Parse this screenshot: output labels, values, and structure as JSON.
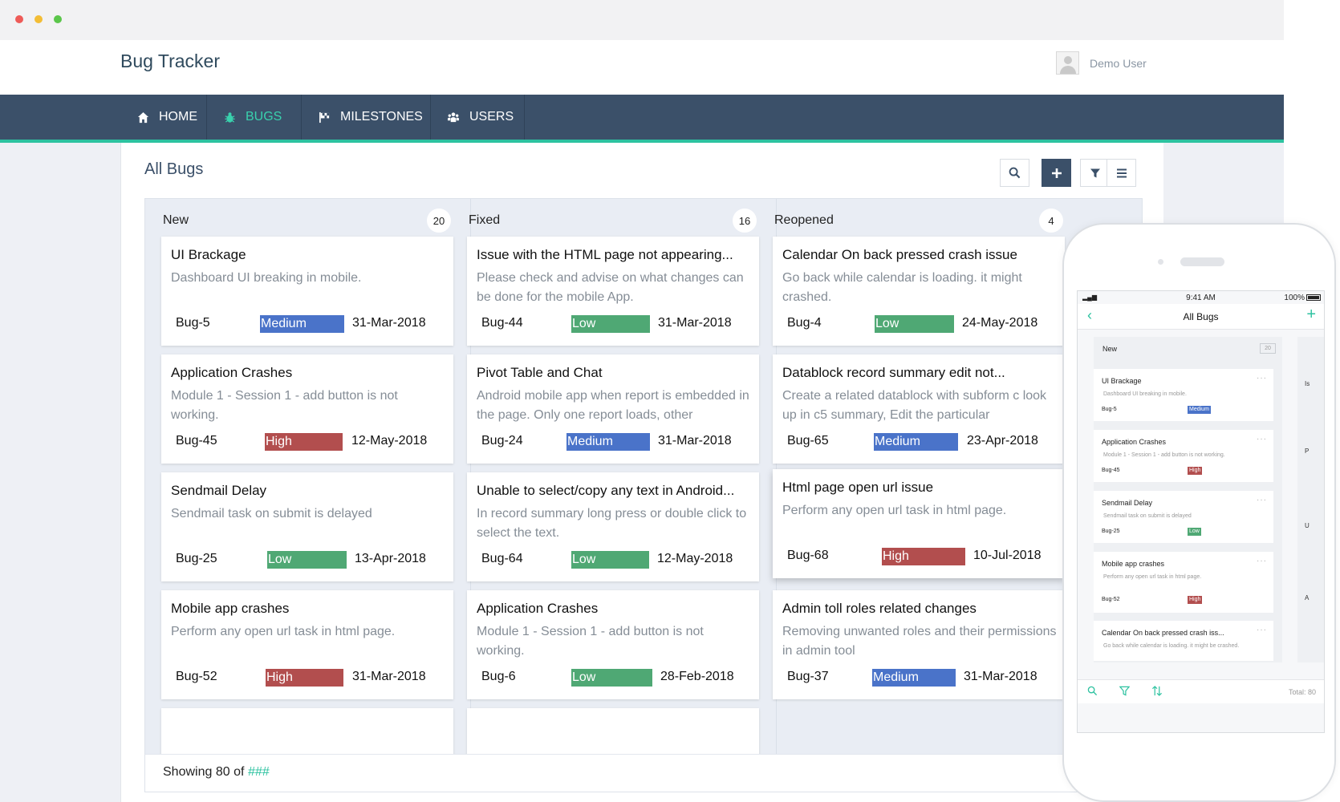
{
  "app": {
    "title": "Bug Tracker",
    "user_name": "Demo User"
  },
  "nav": {
    "items": [
      {
        "label": "HOME",
        "icon": "home-icon",
        "active": false
      },
      {
        "label": "BUGS",
        "icon": "bug-icon",
        "active": true
      },
      {
        "label": "MILESTONES",
        "icon": "flag-icon",
        "active": false
      },
      {
        "label": "USERS",
        "icon": "users-icon",
        "active": false
      }
    ]
  },
  "page": {
    "title": "All Bugs",
    "toolbar": [
      "search-icon",
      "plus-icon",
      "filter-icon",
      "menu-icon"
    ]
  },
  "columns": [
    {
      "name": "New",
      "count": "20",
      "cards": [
        {
          "title": "UI Brackage",
          "desc": "Dashboard UI breaking in mobile.",
          "id": "Bug-5",
          "priority": "Medium",
          "date": "31-Mar-2018"
        },
        {
          "title": "Application Crashes",
          "desc": "Module 1 - Session 1 - add button is not working.",
          "id": "Bug-45",
          "priority": "High",
          "date": "12-May-2018"
        },
        {
          "title": "Sendmail Delay",
          "desc": "Sendmail task on submit is delayed",
          "id": "Bug-25",
          "priority": "Low",
          "date": "13-Apr-2018"
        },
        {
          "title": "Mobile app crashes",
          "desc": "Perform any open url task in html page.",
          "id": "Bug-52",
          "priority": "High",
          "date": "31-Mar-2018"
        }
      ]
    },
    {
      "name": "Fixed",
      "count": "16",
      "cards": [
        {
          "title": "Issue with the HTML page not appearing...",
          "desc": "Please check and advise on what changes can be done for the mobile App.",
          "id": "Bug-44",
          "priority": "Low",
          "date": "31-Mar-2018"
        },
        {
          "title": "Pivot Table and Chat",
          "desc": "Android mobile app when report is embedded in the page. Only one report loads, other",
          "id": "Bug-24",
          "priority": "Medium",
          "date": "31-Mar-2018"
        },
        {
          "title": "Unable to select/copy any text in Android...",
          "desc": "In record summary long press or double click to select the text.",
          "id": "Bug-64",
          "priority": "Low",
          "date": "12-May-2018"
        },
        {
          "title": "Application Crashes",
          "desc": "Module 1 - Session 1 - add button is not working.",
          "id": "Bug-6",
          "priority": "Low",
          "date": "28-Feb-2018"
        }
      ]
    },
    {
      "name": "Reopened",
      "count": "4",
      "cards": [
        {
          "title": "Calendar On back pressed crash issue",
          "desc": "Go back while calendar is loading. it might crashed.",
          "id": "Bug-4",
          "priority": "Low",
          "date": "24-May-2018"
        },
        {
          "title": "Datablock record summary edit not...",
          "desc": "Create a related datablock with subform c look up in c5 summary, Edit the particular",
          "id": "Bug-65",
          "priority": "Medium",
          "date": "23-Apr-2018"
        },
        {
          "title": "Html page open url issue",
          "desc": "Perform any open url task in html page.",
          "id": "Bug-68",
          "priority": "High",
          "date": "10-Jul-2018"
        },
        {
          "title": "Admin toll roles related changes",
          "desc": "Removing unwanted roles and their permissions in admin tool",
          "id": "Bug-37",
          "priority": "Medium",
          "date": "31-Mar-2018"
        }
      ]
    }
  ],
  "footer": {
    "showing_prefix": "Showing 80 of",
    "showing_total": "###"
  },
  "colors": {
    "nav_bg": "#3b5069",
    "accent": "#2dc2a0",
    "medium": "#4a73c9",
    "low": "#4fa874",
    "high": "#b24e4e"
  },
  "mobile": {
    "time": "9:41 AM",
    "battery": "100%",
    "title": "All Bugs",
    "column": "New",
    "column_count": "20",
    "side_letters": [
      "Is",
      "P",
      "U",
      "A"
    ],
    "cards": [
      {
        "title": "UI Brackage",
        "desc": "Dashboard UI breaking in mobile.",
        "id": "Bug-5",
        "priority": "Medium"
      },
      {
        "title": "Application Crashes",
        "desc": "Module 1 - Session 1 - add button is not working.",
        "id": "Bug-45",
        "priority": "High"
      },
      {
        "title": "Sendmail Delay",
        "desc": "Sendmail task on submit is delayed",
        "id": "Bug-25",
        "priority": "Low"
      },
      {
        "title": "Mobile app crashes",
        "desc": "Perform any open url task in html page.",
        "id": "Bug-52",
        "priority": "High"
      },
      {
        "title": "Calendar On back pressed crash iss...",
        "desc": "Go back while calendar is loading. it might be crashed.",
        "id": "",
        "priority": ""
      }
    ],
    "total": "Total: 80"
  }
}
